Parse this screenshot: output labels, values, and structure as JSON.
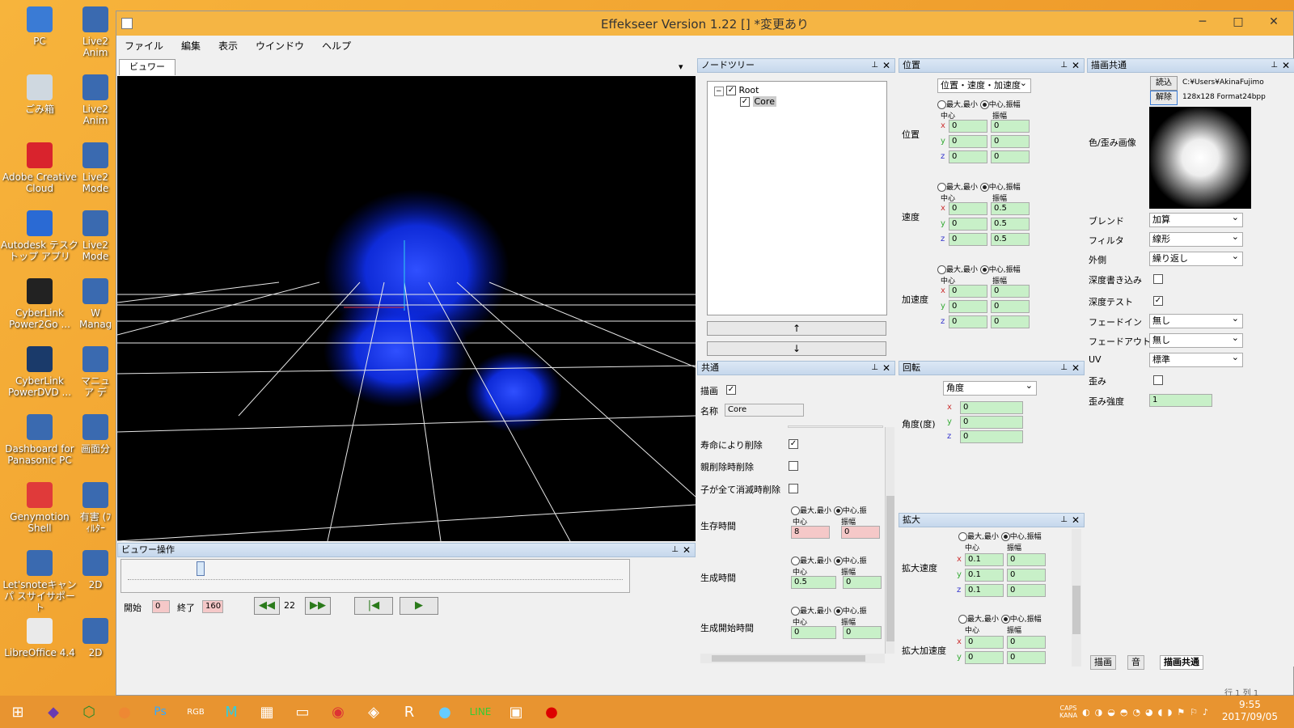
{
  "desktop": {
    "icons": [
      {
        "label": "PC",
        "color": "#3a7bd5"
      },
      {
        "label": "ごみ箱",
        "color": "#cfd8e0"
      },
      {
        "label": "Adobe Creative Cloud",
        "color": "#d9232d"
      },
      {
        "label": "Autodesk テスクトップ アプリ",
        "color": "#2a6ad4"
      },
      {
        "label": "CyberLink Power2Go ...",
        "color": "#222"
      },
      {
        "label": "CyberLink PowerDVD ...",
        "color": "#1a3a6a"
      },
      {
        "label": "Dashboard for Panasonic PC",
        "color": "#3a6ab0"
      },
      {
        "label": "Genymotion Shell",
        "color": "#e03a3a"
      },
      {
        "label": "Let'snoteキャンパ スサイサポート",
        "color": "#3a6ab0"
      },
      {
        "label": "LibreOffice 4.4",
        "color": "#eaeaea"
      }
    ],
    "icons2": [
      "Live2 Anim",
      "Live2 Anim",
      "Live2 Mode",
      "Live2 Mode",
      "W Manag",
      "マニュア デ",
      "画面分",
      "有害 (ﾌｨﾙﾀｰ",
      "2D",
      "2D"
    ]
  },
  "window": {
    "title": "Effekseer Version 1.22 [] *変更あり",
    "minimize": "─",
    "maximize": "□",
    "close": "✕"
  },
  "menu": [
    "ファイル",
    "編集",
    "表示",
    "ウインドウ",
    "ヘルプ"
  ],
  "viewer": {
    "tab": "ビュワー",
    "dropdown": "▾"
  },
  "viewer_ops": {
    "title": "ビュワー操作",
    "start_label": "開始",
    "start_value": "0",
    "end_label": "終了",
    "end_value": "160",
    "frame": "22",
    "slider_fraction": 0.14
  },
  "node_tree": {
    "title": "ノードツリー",
    "root": "Root",
    "child": "Core",
    "up": "↑",
    "down": "↓"
  },
  "common": {
    "title": "共通",
    "draw_label": "描画",
    "name_label": "名称",
    "name_value": "Core",
    "life_delete": "寿命により削除",
    "parent_delete": "親削除時削除",
    "child_delete": "子が全て消滅時削除",
    "life_time": "生存時間",
    "gen_time": "生成時間",
    "gen_start": "生成開始時間",
    "radio_minmax": "最大,最小",
    "radio_center": "中心,振",
    "center": "中心",
    "amp": "振幅",
    "life_center": "8",
    "life_amp": "0",
    "gen_center": "0.5",
    "gen_amp": "0",
    "start_center": "0",
    "start_amp": "0"
  },
  "position": {
    "title": "位置",
    "mode": "位置・速度・加速度",
    "radio_minmax": "最大,最小",
    "radio_center": "中心,振幅",
    "center": "中心",
    "amp": "振幅",
    "pos_label": "位置",
    "vel_label": "速度",
    "acc_label": "加速度",
    "pos": {
      "x": [
        "0",
        "0"
      ],
      "y": [
        "0",
        "0"
      ],
      "z": [
        "0",
        "0"
      ]
    },
    "vel": {
      "x": [
        "0",
        "0.5"
      ],
      "y": [
        "0",
        "0.5"
      ],
      "z": [
        "0",
        "0.5"
      ]
    },
    "acc": {
      "x": [
        "0",
        "0"
      ],
      "y": [
        "0",
        "0"
      ],
      "z": [
        "0",
        "0"
      ]
    }
  },
  "rotation": {
    "title": "回転",
    "mode": "角度",
    "label": "角度(度)",
    "x": "0",
    "y": "0",
    "z": "0"
  },
  "scale": {
    "title": "拡大",
    "radio_minmax": "最大,最小",
    "radio_center": "中心,振幅",
    "center": "中心",
    "amp": "振幅",
    "speed_label": "拡大速度",
    "accel_label": "拡大加速度",
    "speed": {
      "x": [
        "0.1",
        "0"
      ],
      "y": [
        "0.1",
        "0"
      ],
      "z": [
        "0.1",
        "0"
      ]
    },
    "accel": {
      "x": [
        "0",
        "0"
      ],
      "y": [
        "0",
        "0"
      ]
    }
  },
  "render_common": {
    "title": "描画共通",
    "load": "読込",
    "unload": "解除",
    "path": "C:¥Users¥AkinaFujimo",
    "format": "128x128 Format24bpp",
    "image_label": "色/歪み画像",
    "blend_label": "ブレンド",
    "blend": "加算",
    "filter_label": "フィルタ",
    "filter": "線形",
    "wrap_label": "外側",
    "wrap": "繰り返し",
    "depth_write": "深度書き込み",
    "depth_test": "深度テスト",
    "fadein_label": "フェードイン",
    "fadein": "無し",
    "fadeout_label": "フェードアウト",
    "fadeout": "無し",
    "uv_label": "UV",
    "uv": "標準",
    "distort_label": "歪み",
    "distort_strength_label": "歪み強度",
    "distort_strength": "1",
    "tabs": [
      "描画",
      "音",
      "描画共通"
    ]
  },
  "status": {
    "text": "行 1 列 1"
  },
  "taskbar": {
    "clock_time": "9:55",
    "clock_date": "2017/09/05",
    "caps": "CAPS",
    "kana": "KANA"
  }
}
